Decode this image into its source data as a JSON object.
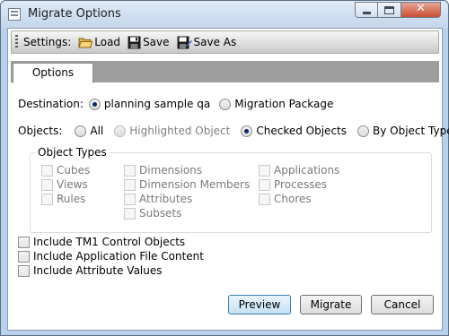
{
  "window": {
    "title": "Migrate Options"
  },
  "toolbar": {
    "settings_label": "Settings:",
    "load_label": "Load",
    "save_label": "Save",
    "save_as_label": "Save As"
  },
  "tabs": [
    {
      "label": "Options",
      "selected": true
    }
  ],
  "destination": {
    "label": "Destination:",
    "options": [
      {
        "label": "planning sample qa",
        "selected": true
      },
      {
        "label": "Migration Package",
        "selected": false
      }
    ]
  },
  "objects": {
    "label": "Objects:",
    "options": [
      {
        "label": "All",
        "selected": false,
        "enabled": true
      },
      {
        "label": "Highlighted Object",
        "selected": false,
        "enabled": false
      },
      {
        "label": "Checked Objects",
        "selected": true,
        "enabled": true
      },
      {
        "label": "By Object Type",
        "selected": false,
        "enabled": true
      }
    ]
  },
  "object_types": {
    "title": "Object Types",
    "columns": [
      [
        "Cubes",
        "Views",
        "Rules"
      ],
      [
        "Dimensions",
        "Dimension Members",
        "Attributes",
        "Subsets"
      ],
      [
        "Applications",
        "Processes",
        "Chores"
      ]
    ]
  },
  "include_options": [
    {
      "label": "Include TM1 Control Objects",
      "checked": false
    },
    {
      "label": "Include Application File Content",
      "checked": false
    },
    {
      "label": "Include Attribute Values",
      "checked": false
    }
  ],
  "buttons": {
    "preview": "Preview",
    "migrate": "Migrate",
    "cancel": "Cancel"
  },
  "colors": {
    "selected_radio": "#0f2d6a",
    "disabled_text": "#808080"
  }
}
